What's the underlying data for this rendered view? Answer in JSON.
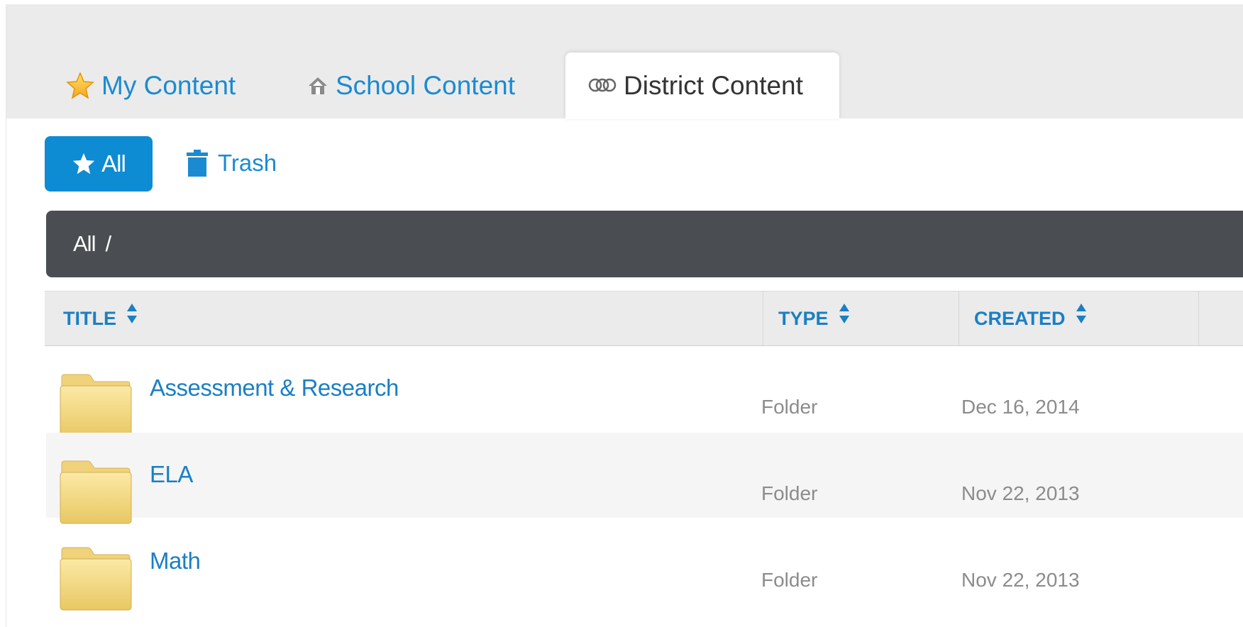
{
  "tabs": {
    "my_content": {
      "label": "My Content",
      "icon": "star-icon"
    },
    "school_content": {
      "label": "School Content",
      "icon": "school-icon"
    },
    "district_content": {
      "label": "District Content",
      "icon": "district-icon"
    },
    "active": "district_content"
  },
  "toolbar": {
    "all_label": "All",
    "trash_label": "Trash"
  },
  "breadcrumb": {
    "items": [
      "All"
    ],
    "separator": "/"
  },
  "table": {
    "columns": [
      "TITLE",
      "TYPE",
      "CREATED"
    ],
    "rows": [
      {
        "title": "Assessment & Research",
        "type": "Folder",
        "created": "Dec 16, 2014"
      },
      {
        "title": "ELA",
        "type": "Folder",
        "created": "Nov 22, 2013"
      },
      {
        "title": "Math",
        "type": "Folder",
        "created": "Nov 22, 2013"
      }
    ]
  },
  "colors": {
    "accent": "#0d8bd3",
    "link": "#1a8bd1",
    "breadcrumb_bg": "#4a4e52",
    "folder": "#f2d98a"
  }
}
